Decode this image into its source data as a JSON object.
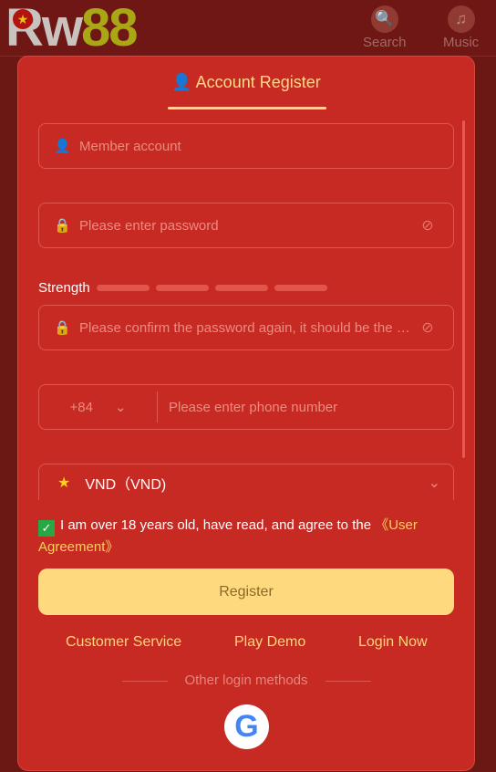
{
  "header": {
    "logo": "Rw88",
    "logo_rw": "Rw",
    "logo_num": "88",
    "search_label": "Search",
    "music_label": "Music"
  },
  "modal": {
    "title": "Account Register",
    "member_placeholder": "Member account",
    "password_placeholder": "Please enter password",
    "strength_label": "Strength",
    "confirm_placeholder": "Please confirm the password again, it should be the same",
    "country_code": "+84",
    "phone_placeholder": "Please enter phone number",
    "currency": "VND（VND)",
    "agree_text": "I am over 18 years old, have read, and agree to the ",
    "agree_link": "《User Agreement》",
    "agree_checked": true,
    "register_label": "Register",
    "links": [
      "Customer Service",
      "Play Demo",
      "Login Now"
    ],
    "other_login": "Other login methods",
    "google_icon": "google-icon"
  },
  "colors": {
    "accent": "#ffd98a",
    "modal_bg": "#c62a22",
    "page_bg": "#6b1713"
  }
}
